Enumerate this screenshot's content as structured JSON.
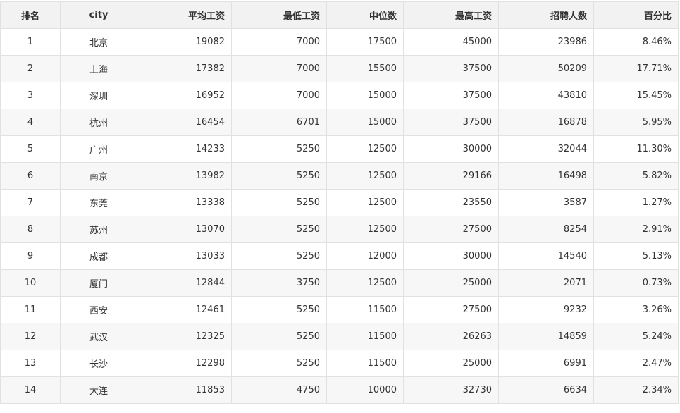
{
  "table": {
    "headers": [
      "排名",
      "city",
      "平均工资",
      "最低工资",
      "中位数",
      "最高工资",
      "招聘人数",
      "百分比"
    ],
    "rows": [
      [
        "1",
        "北京",
        "19082",
        "7000",
        "17500",
        "45000",
        "23986",
        "8.46%"
      ],
      [
        "2",
        "上海",
        "17382",
        "7000",
        "15500",
        "37500",
        "50209",
        "17.71%"
      ],
      [
        "3",
        "深圳",
        "16952",
        "7000",
        "15000",
        "37500",
        "43810",
        "15.45%"
      ],
      [
        "4",
        "杭州",
        "16454",
        "6701",
        "15000",
        "37500",
        "16878",
        "5.95%"
      ],
      [
        "5",
        "广州",
        "14233",
        "5250",
        "12500",
        "30000",
        "32044",
        "11.30%"
      ],
      [
        "6",
        "南京",
        "13982",
        "5250",
        "12500",
        "29166",
        "16498",
        "5.82%"
      ],
      [
        "7",
        "东莞",
        "13338",
        "5250",
        "12500",
        "23550",
        "3587",
        "1.27%"
      ],
      [
        "8",
        "苏州",
        "13070",
        "5250",
        "12500",
        "27500",
        "8254",
        "2.91%"
      ],
      [
        "9",
        "成都",
        "13033",
        "5250",
        "12000",
        "30000",
        "14540",
        "5.13%"
      ],
      [
        "10",
        "厦门",
        "12844",
        "3750",
        "12500",
        "25000",
        "2071",
        "0.73%"
      ],
      [
        "11",
        "西安",
        "12461",
        "5250",
        "11500",
        "27500",
        "9232",
        "3.26%"
      ],
      [
        "12",
        "武汉",
        "12325",
        "5250",
        "11500",
        "26263",
        "14859",
        "5.24%"
      ],
      [
        "13",
        "长沙",
        "12298",
        "5250",
        "11500",
        "25000",
        "6991",
        "2.47%"
      ],
      [
        "14",
        "大连",
        "11853",
        "4750",
        "10000",
        "32730",
        "6634",
        "2.34%"
      ]
    ]
  }
}
